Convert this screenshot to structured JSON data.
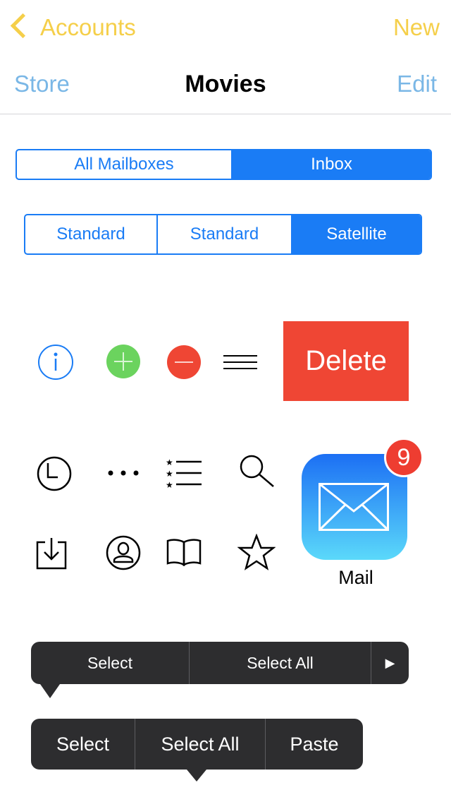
{
  "nav_top": {
    "back_label": "Accounts",
    "new_label": "New"
  },
  "nav_main": {
    "left_label": "Store",
    "title": "Movies",
    "right_label": "Edit"
  },
  "segment_mail": {
    "items": [
      "All Mailboxes",
      "Inbox"
    ],
    "selected": "Inbox"
  },
  "segment_map": {
    "items": [
      "Standard",
      "Standard",
      "Satellite"
    ],
    "selected": "Satellite"
  },
  "icons_row1": [
    "info-icon",
    "add-icon",
    "remove-icon",
    "reorder-icon"
  ],
  "delete_label": "Delete",
  "icons_row2": [
    "clock-icon",
    "more-icon",
    "list-icon",
    "search-icon"
  ],
  "icons_row3": [
    "download-icon",
    "contact-icon",
    "book-icon",
    "star-icon"
  ],
  "mail_app": {
    "label": "Mail",
    "badge": "9"
  },
  "menu_small": {
    "items": [
      "Select",
      "Select All"
    ],
    "arrow": "▶"
  },
  "menu_large": {
    "items": [
      "Select",
      "Select All",
      "Paste"
    ]
  },
  "colors": {
    "accent_blue": "#1a7cf5",
    "yellow": "#f5cf4a",
    "red": "#ef4634",
    "green": "#6bd35e"
  }
}
